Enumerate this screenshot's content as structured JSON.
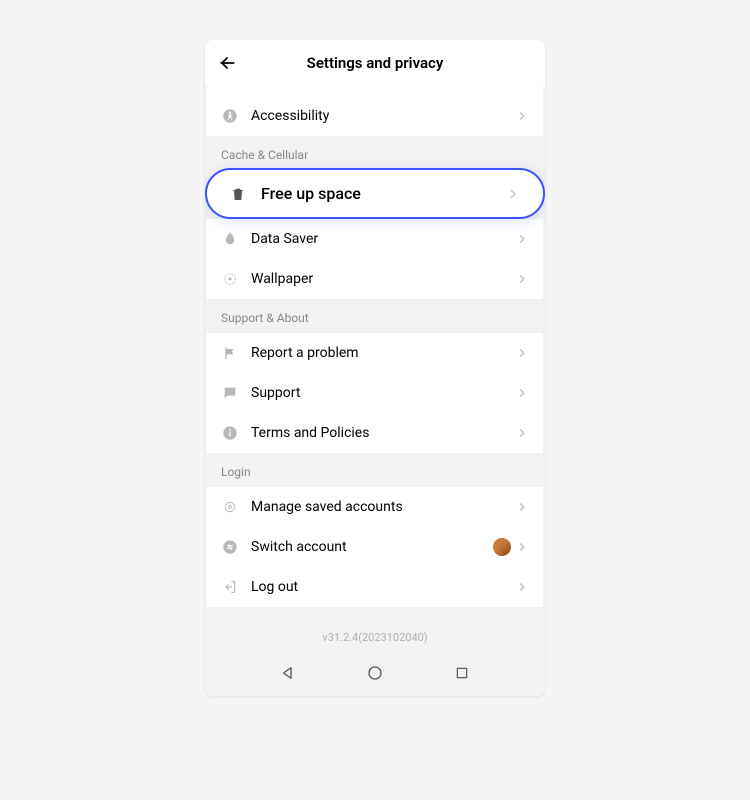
{
  "header": {
    "title": "Settings and privacy"
  },
  "groups": {
    "top_cutoff": {
      "items": [
        {
          "label": "Accessibility",
          "icon": "accessibility-icon"
        }
      ]
    },
    "cache": {
      "title": "Cache & Cellular",
      "items": [
        {
          "label": "Free up space",
          "icon": "trash-icon",
          "highlight": true
        },
        {
          "label": "Data Saver",
          "icon": "datasaver-icon"
        },
        {
          "label": "Wallpaper",
          "icon": "wallpaper-icon"
        }
      ]
    },
    "support": {
      "title": "Support & About",
      "items": [
        {
          "label": "Report a problem",
          "icon": "flag-icon"
        },
        {
          "label": "Support",
          "icon": "support-chat-icon"
        },
        {
          "label": "Terms and Policies",
          "icon": "info-icon"
        }
      ]
    },
    "login": {
      "title": "Login",
      "items": [
        {
          "label": "Manage saved accounts",
          "icon": "gear-outline-icon"
        },
        {
          "label": "Switch account",
          "icon": "swap-icon",
          "avatar": true
        },
        {
          "label": "Log out",
          "icon": "logout-icon"
        }
      ]
    }
  },
  "footer": {
    "version": "v31.2.4(2023102040)"
  }
}
